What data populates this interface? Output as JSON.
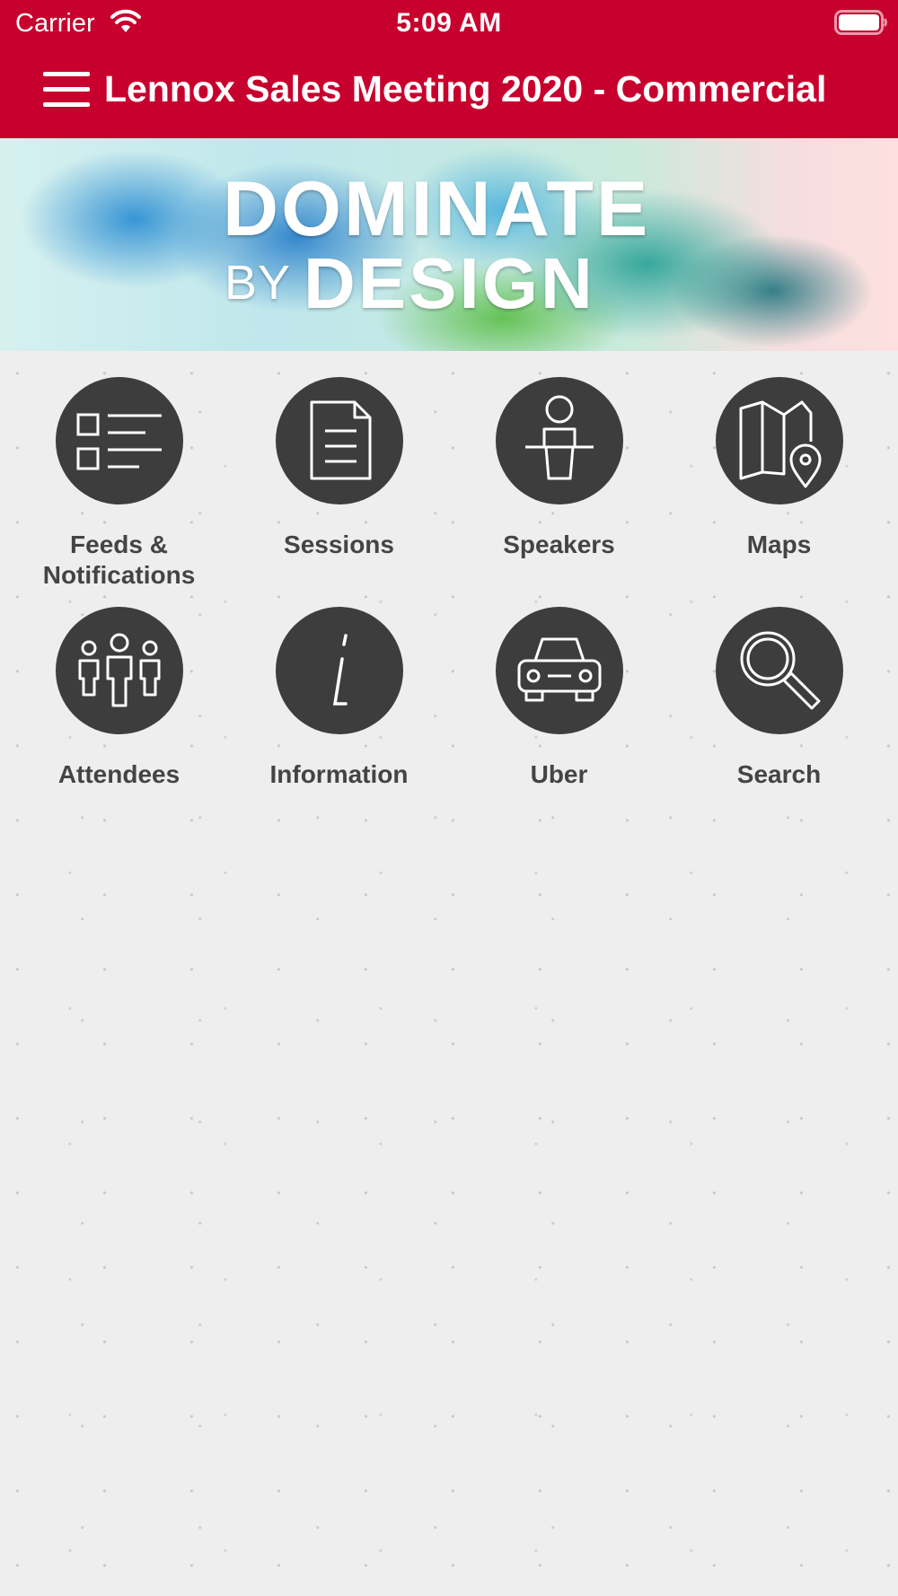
{
  "status_bar": {
    "carrier": "Carrier",
    "time": "5:09 AM"
  },
  "header": {
    "title": "Lennox Sales Meeting 2020 - Commercial",
    "menu_icon": "hamburger-menu-icon",
    "background_color": "#c8002d"
  },
  "banner": {
    "line1": "DOMINATE",
    "by": "BY",
    "line2": "DESIGN"
  },
  "tiles": [
    {
      "label": "Feeds & Notifications",
      "icon": "list-icon"
    },
    {
      "label": "Sessions",
      "icon": "document-icon"
    },
    {
      "label": "Speakers",
      "icon": "podium-speaker-icon"
    },
    {
      "label": "Maps",
      "icon": "map-pin-icon"
    },
    {
      "label": "Attendees",
      "icon": "people-icon"
    },
    {
      "label": "Information",
      "icon": "info-icon"
    },
    {
      "label": "Uber",
      "icon": "car-icon"
    },
    {
      "label": "Search",
      "icon": "search-icon"
    }
  ],
  "colors": {
    "accent": "#c8002d",
    "icon_circle": "#3d3d3d",
    "label_text": "#444444",
    "background": "#eeeeee"
  }
}
